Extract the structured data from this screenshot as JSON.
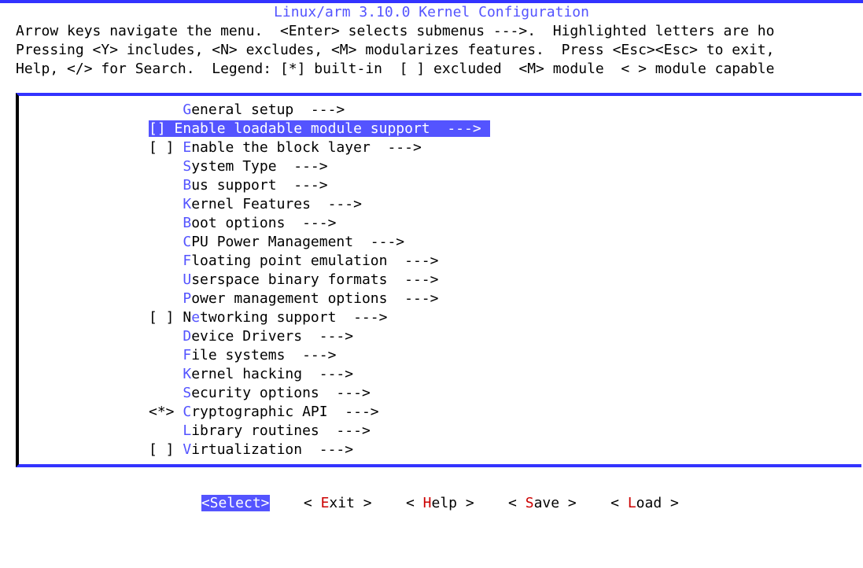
{
  "title": "Linux/arm 3.10.0 Kernel Configuration",
  "help_lines": [
    "Arrow keys navigate the menu.  <Enter> selects submenus --->.  Highlighted letters are ho",
    "Pressing <Y> includes, <N> excludes, <M> modularizes features.  Press <Esc><Esc> to exit,",
    "Help, </> for Search.  Legend: [*] built-in  [ ] excluded  <M> module  < > module capable"
  ],
  "arrow": "  --->",
  "menu": [
    {
      "prefix": "    ",
      "hk": "G",
      "label": "eneral setup",
      "selected": false
    },
    {
      "prefix": "[*] ",
      "hk": "E",
      "label": "nable loadable module support",
      "selected": true
    },
    {
      "prefix": "[ ] ",
      "hk": "E",
      "label": "nable the block layer",
      "selected": false
    },
    {
      "prefix": "    ",
      "hk": "S",
      "label": "ystem Type",
      "selected": false
    },
    {
      "prefix": "    ",
      "hk": "B",
      "label": "us support",
      "selected": false
    },
    {
      "prefix": "    ",
      "hk": "K",
      "label": "ernel Features",
      "selected": false
    },
    {
      "prefix": "    ",
      "hk": "B",
      "label": "oot options",
      "selected": false
    },
    {
      "prefix": "    ",
      "hk": "C",
      "label": "PU Power Management",
      "selected": false
    },
    {
      "prefix": "    ",
      "hk": "F",
      "label": "loating point emulation",
      "selected": false
    },
    {
      "prefix": "    ",
      "hk": "U",
      "label": "serspace binary formats",
      "selected": false
    },
    {
      "prefix": "    ",
      "hk": "P",
      "label": "ower management options",
      "selected": false
    },
    {
      "prefix": "[ ] ",
      "hk": "N",
      "pre": "N",
      "mid": "e",
      "label": "tworking support",
      "selected": false
    },
    {
      "prefix": "    ",
      "hk": "D",
      "label": "evice Drivers",
      "selected": false
    },
    {
      "prefix": "    ",
      "hk": "F",
      "label": "ile systems",
      "selected": false
    },
    {
      "prefix": "    ",
      "hk": "K",
      "label": "ernel hacking",
      "selected": false
    },
    {
      "prefix": "    ",
      "hk": "S",
      "label": "ecurity options",
      "selected": false
    },
    {
      "prefix": "<*> ",
      "hk": "C",
      "label": "ryptographic API",
      "selected": false
    },
    {
      "prefix": "    ",
      "hk": "L",
      "label": "ibrary routines",
      "selected": false
    },
    {
      "prefix": "[ ] ",
      "hk": "V",
      "label": "irtualization",
      "selected": false
    }
  ],
  "buttons": {
    "select": "<Select>",
    "exit_pre": "< ",
    "exit_hk": "E",
    "exit_post": "xit >",
    "help_pre": "< ",
    "help_hk": "H",
    "help_post": "elp >",
    "save_pre": "< ",
    "save_hk": "S",
    "save_post": "ave >",
    "load_pre": "< ",
    "load_hk": "L",
    "load_post": "oad >",
    "gap": "    "
  },
  "watermark": ""
}
